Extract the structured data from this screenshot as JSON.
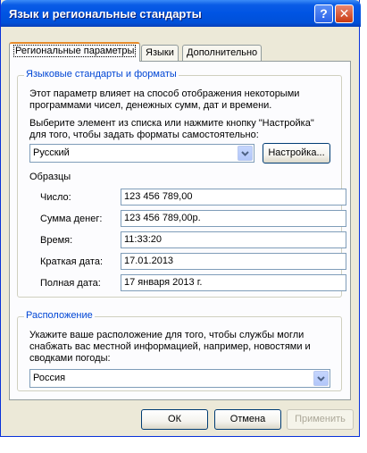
{
  "window": {
    "title": "Язык и региональные стандарты",
    "help_label": "?",
    "close_label": "✕"
  },
  "tabs": [
    {
      "label": "Региональные параметры",
      "active": true
    },
    {
      "label": "Языки",
      "active": false
    },
    {
      "label": "Дополнительно",
      "active": false
    }
  ],
  "formats_group": {
    "legend": "Языковые стандарты и форматы",
    "description_line1": "Этот параметр влияет на способ отображения некоторыми",
    "description_line2": "программами чисел, денежных сумм, дат и времени.",
    "instruction_line1": "Выберите элемент из списка или нажмите кнопку \"Настройка\"",
    "instruction_line2": "для того, чтобы задать форматы самостоятельно:",
    "locale_value": "Русский",
    "customize_label": "Настройка...",
    "samples_label": "Образцы",
    "samples": [
      {
        "label": "Число:",
        "value": "123 456 789,00"
      },
      {
        "label": "Сумма денег:",
        "value": "123 456 789,00р."
      },
      {
        "label": "Время:",
        "value": "11:33:20"
      },
      {
        "label": "Краткая дата:",
        "value": "17.01.2013"
      },
      {
        "label": "Полная дата:",
        "value": "17 января 2013 г."
      }
    ]
  },
  "location_group": {
    "legend": "Расположение",
    "description_line1": "Укажите ваше расположение для того, чтобы службы могли",
    "description_line2": "снабжать вас местной информацией, например, новостями и",
    "description_line3": "сводками погоды:",
    "location_value": "Россия"
  },
  "buttons": {
    "ok_label": "ОК",
    "cancel_label": "Отмена",
    "apply_label": "Применить"
  },
  "colors": {
    "titlebar": "#0054e3",
    "dialog_bg": "#ece9d8",
    "group_legend": "#0046d5",
    "active_tab_accent": "#e68b2c"
  }
}
